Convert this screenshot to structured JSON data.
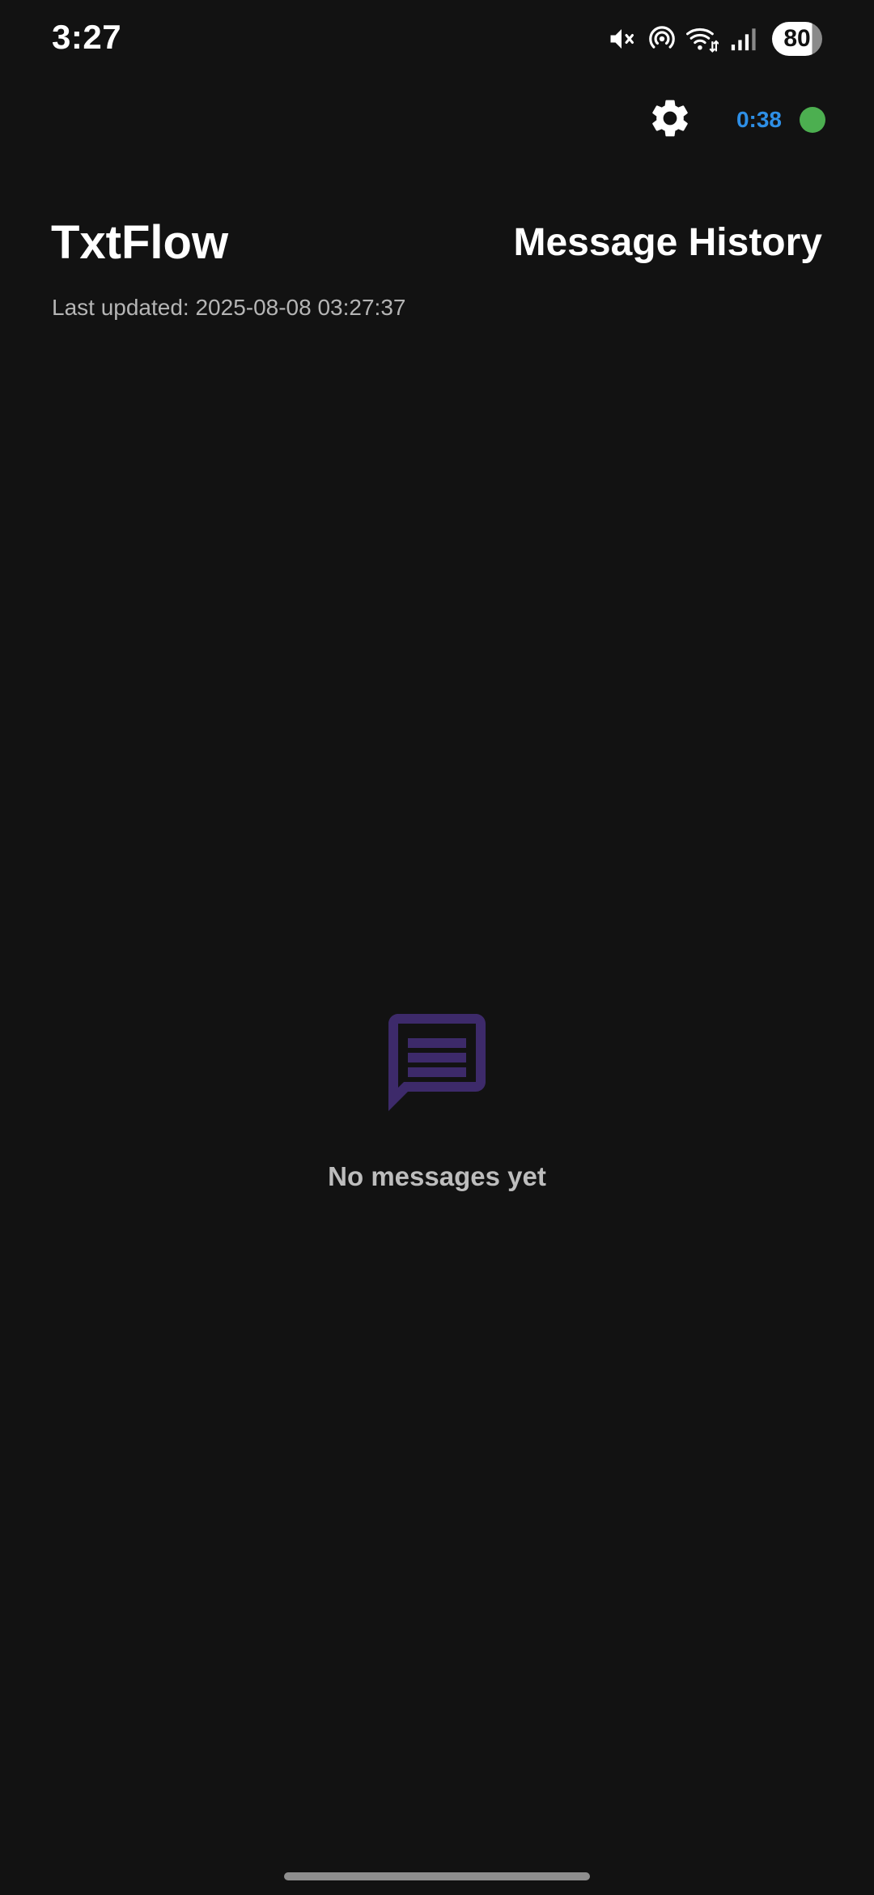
{
  "status_bar": {
    "time": "3:27",
    "battery": "80",
    "icons": [
      "mute-icon",
      "hotspot-icon",
      "wifi-icon",
      "signal-icon"
    ]
  },
  "toolbar": {
    "settings_icon": "gear-icon",
    "timer": "0:38",
    "status_color": "#4caf50",
    "timer_color": "#2e8fe6"
  },
  "header": {
    "app_title": "TxtFlow",
    "section_title": "Message History",
    "last_updated": "Last updated: 2025-08-08 03:27:37"
  },
  "empty_state": {
    "icon": "message-icon",
    "icon_color": "#3d2a6a",
    "text": "No messages yet"
  }
}
